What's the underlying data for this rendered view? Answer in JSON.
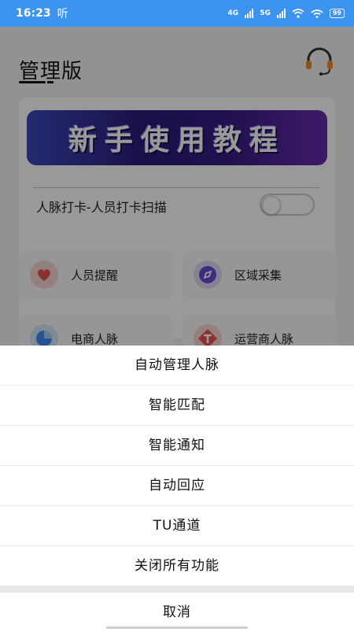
{
  "status_bar": {
    "time": "16:23",
    "carrier_label": "听",
    "net_4g": "4G",
    "net_5g": "5G",
    "battery": "99"
  },
  "page": {
    "title": "管理版",
    "banner_text": "新手使用教程",
    "scan_toggle": {
      "label": "人脉打卡-人员打卡扫描",
      "on": false
    },
    "features": [
      {
        "label": "人员提醒",
        "icon": "heart-icon",
        "color": "#e8534d"
      },
      {
        "label": "区域采集",
        "icon": "compass-icon",
        "color": "#6a4ad6"
      },
      {
        "label": "电商人脉",
        "icon": "pie-chart-icon",
        "color": "#3d8ef0"
      },
      {
        "label": "运营商人脉",
        "icon": "letter-t-icon",
        "color": "#e8534d"
      }
    ]
  },
  "action_sheet": {
    "items": [
      "自动管理人脉",
      "智能匹配",
      "智能通知",
      "自动回应",
      "TU通道",
      "关闭所有功能"
    ],
    "cancel_label": "取消"
  },
  "colors": {
    "status_bar": "#3d93f0",
    "scrim": "rgba(0,0,0,0.4)"
  }
}
